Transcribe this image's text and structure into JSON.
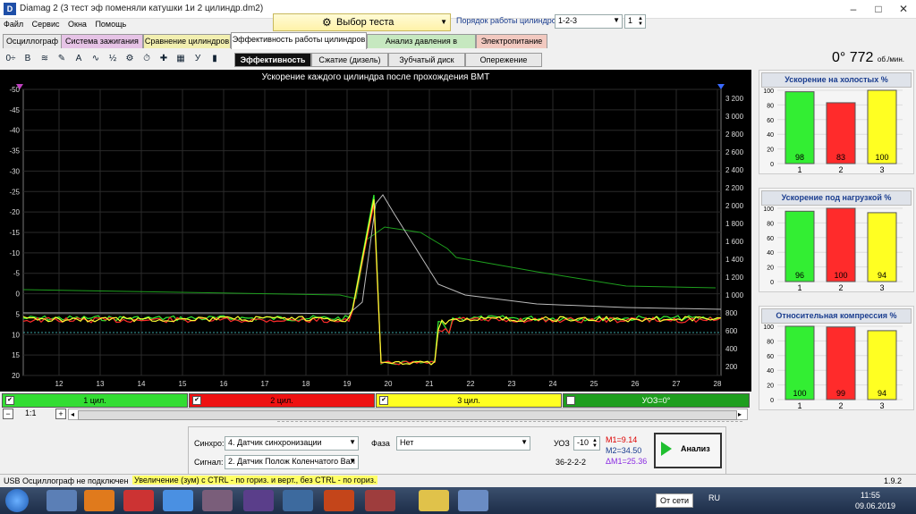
{
  "window": {
    "title": "Diamag 2 (3 тест эф поменяли катушки 1и 2 цилиндр.dm2)",
    "app_badge": "D"
  },
  "menu": [
    "Файл",
    "Сервис",
    "Окна",
    "Помощь"
  ],
  "test_select": {
    "label": "Выбор теста"
  },
  "cylinder_order": {
    "label": "Порядок работы цилиндров",
    "value": "1-2-3",
    "spinner": "1"
  },
  "tabs": [
    "Осциллограф",
    "Система зажигания",
    "Сравнение цилиндров",
    "Эффективность работы цилиндров",
    "Анализ давления в цилиндре",
    "Электропитание"
  ],
  "tab_colors": [
    "#e9e9e9",
    "#e6c3e6",
    "#f2efb0",
    "#ffffff",
    "#c6e8c0",
    "#f2c9c0"
  ],
  "subtabs": [
    "Эффективность",
    "Сжатие (дизель)",
    "Зубчатый диск",
    "Опережение"
  ],
  "toolbar_icons": [
    "zoom-icon",
    "bold-b-icon",
    "wave-icon",
    "edit-icon",
    "spark-icon",
    "curve-icon",
    "ratio-icon",
    "tool-icon",
    "time-icon",
    "marker-icon",
    "grid-icon",
    "uoz-icon",
    "bars-icon"
  ],
  "toolbar_glyphs": [
    "0÷",
    "B",
    "≋",
    "✎",
    "A",
    "∿",
    "½",
    "⚙",
    "⏱",
    "✚",
    "▦",
    "У",
    "▮"
  ],
  "rpm": {
    "deg": "0°",
    "value": "772",
    "unit": "об./мин."
  },
  "plot": {
    "title": "Ускорение каждого цилиндра после прохождения ВМТ",
    "x_ticks": [
      "12",
      "13",
      "14",
      "15",
      "16",
      "17",
      "18",
      "19",
      "20",
      "21",
      "22",
      "23",
      "24",
      "25",
      "26",
      "27",
      "28"
    ],
    "y_left_ticks": [
      "-50",
      "-45",
      "-40",
      "-35",
      "-30",
      "-25",
      "-20",
      "-15",
      "-10",
      "-5",
      "0",
      "5",
      "10",
      "15",
      "20"
    ],
    "y_right_ticks": [
      "3 200",
      "3 000",
      "2 800",
      "2 600",
      "2 400",
      "2 200",
      "2 000",
      "1 800",
      "1 600",
      "1 400",
      "1 200",
      "1 000",
      "800",
      "600",
      "400",
      "200"
    ]
  },
  "channels": [
    {
      "label": "1 цил.",
      "color": "#33dd33"
    },
    {
      "label": "2 цил.",
      "color": "#ee1111"
    },
    {
      "label": "3 цил.",
      "color": "#ffff22"
    },
    {
      "label": "УОЗ=0°",
      "color": "#1e9e1e"
    }
  ],
  "scroll": {
    "scale": "1:1"
  },
  "bottom": {
    "sync_label": "Синхро:",
    "sync_value": "4. Датчик синхронизации",
    "signal_label": "Сигнал:",
    "signal_value": "2. Датчик Полож Коленчатого Вал",
    "phase_label": "Фаза",
    "phase_value": "Нет",
    "uoz_label": "УОЗ",
    "uoz_value": "-10",
    "code": "36-2-2-2",
    "m1": "M1=9.14",
    "m2": "M2=34.50",
    "dm1": "ΔM1=25.36",
    "analyze": "Анализ"
  },
  "status": {
    "left": "USB Осциллограф не подключен",
    "hint": "Увеличение (зум) с CTRL - по гориз. и верт., без CTRL - по гориз.",
    "version": "1.9.2"
  },
  "taskbar": {
    "network": "От сети",
    "lang": "RU",
    "time": "11:55",
    "date": "09.06.2019"
  },
  "rpanels": [
    {
      "title": "Ускорение на холостых %",
      "values": [
        98,
        83,
        100
      ],
      "labels": [
        "98",
        "83",
        "100"
      ]
    },
    {
      "title": "Ускорение под нагрузкой %",
      "values": [
        96,
        100,
        94
      ],
      "labels": [
        "96",
        "100",
        "94"
      ]
    },
    {
      "title": "Относительная компрессия %",
      "values": [
        100,
        99,
        94
      ],
      "labels": [
        "100",
        "99",
        "94"
      ]
    }
  ],
  "rpanel_axis": [
    "100",
    "80",
    "60",
    "40",
    "20",
    "0"
  ],
  "rpanel_cats": [
    "1",
    "2",
    "3"
  ],
  "rpanel_colors": [
    "#33ee33",
    "#ff2b2b",
    "#ffff22"
  ]
}
